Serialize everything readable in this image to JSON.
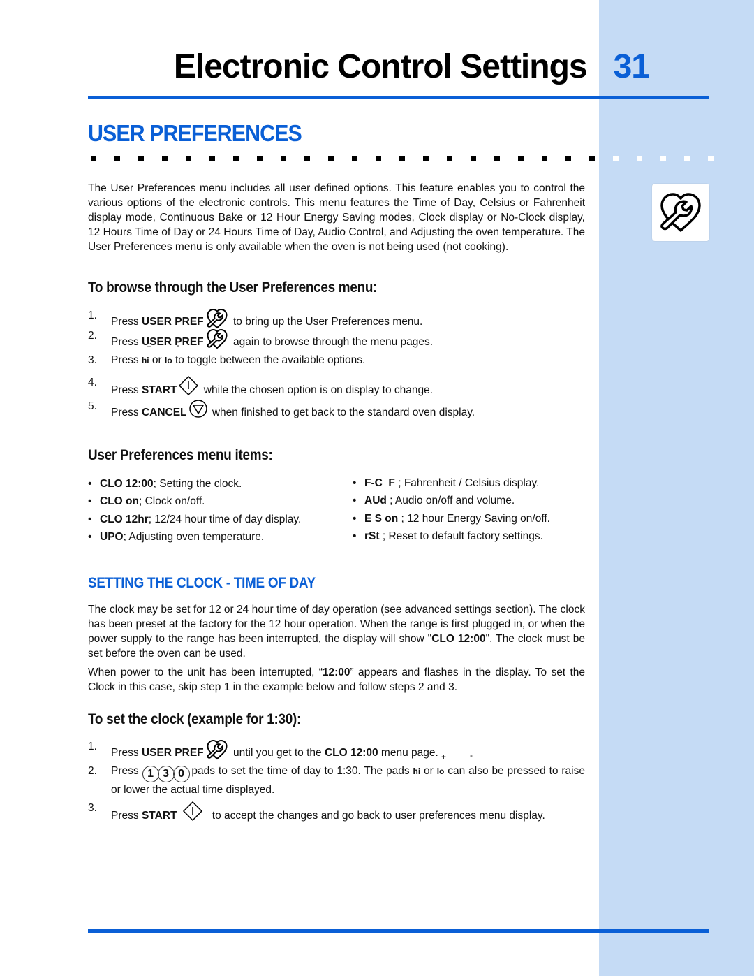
{
  "header": {
    "title": "Electronic Control Settings",
    "page_number": "31"
  },
  "section": {
    "title": "USER PREFERENCES"
  },
  "colors": {
    "accent": "#0a5fd6",
    "sidebar": "#c5dbf5"
  },
  "sidebar_icon": "user-pref-icon",
  "intro": "The User Preferences menu includes all user defined options. This feature enables you to control the various options of the electronic controls. This menu features the Time of Day, Celsius or Fahrenheit display mode, Continuous Bake or 12 Hour Energy Saving modes, Clock display or No-Clock display, 12 Hours Time of Day or 24 Hours Time of Day, Audio Control, and Adjusting the oven temperature. The User Preferences menu is only available when the oven is not being used (not cooking).",
  "browse": {
    "heading": "To browse through the User Preferences menu:",
    "steps": [
      {
        "num": "1.",
        "pre": "Press ",
        "key": "USER PREF",
        "post": " to bring up the User Preferences menu."
      },
      {
        "num": "2.",
        "pre": "Press ",
        "key": "USER PREF",
        "post": " again to browse through the menu pages."
      },
      {
        "num": "3.",
        "pre": "Press ",
        "hi": "hi",
        "or": " or ",
        "lo": "lo",
        "post": " to toggle between the available options.",
        "plus": "+",
        "minus": "-"
      },
      {
        "num": "4.",
        "pre": "Press ",
        "key": "START",
        "post": " while the chosen option is on display to change."
      },
      {
        "num": "5.",
        "pre": "Press ",
        "key": "CANCEL",
        "post": " when finished to get back to the standard oven display."
      }
    ]
  },
  "menu_items": {
    "heading": "User Preferences menu items:",
    "left": [
      {
        "code": "CLO 12:00",
        "desc": "; Setting the clock."
      },
      {
        "code": "CLO on",
        "desc": "; Clock on/off."
      },
      {
        "code": "CLO 12hr",
        "desc": "; 12/24 hour time of day display."
      },
      {
        "code": "UPO",
        "desc": "; Adjusting oven temperature."
      }
    ],
    "right": [
      {
        "code": "F-C  F",
        "desc": " ; Fahrenheit / Celsius display."
      },
      {
        "code": "AUd",
        "desc": " ; Audio on/off and volume."
      },
      {
        "code": "E S on",
        "desc": " ; 12 hour Energy Saving on/off."
      },
      {
        "code": "rSt",
        "desc": " ; Reset to default factory settings."
      }
    ]
  },
  "clock": {
    "heading": "SETTING THE CLOCK - TIME OF DAY",
    "para1_pre": "The clock may be set for 12 or 24 hour time of day operation (see advanced settings section). The clock has been preset at the factory for the 12 hour operation. When the range is first plugged in, or when the power supply to the range has been interrupted, the display will show \"",
    "para1_bold": "CLO 12:00",
    "para1_post": "\". The clock must be set before the oven can be used.",
    "para2_pre": "When power to the unit has been interrupted, “",
    "para2_bold": "12:00",
    "para2_post": "” appears and flashes in the display. To set the Clock in this case, skip step 1 in the example below and follow steps 2 and 3."
  },
  "set_clock": {
    "heading": "To set the clock (example for 1:30):",
    "step1": {
      "num": "1.",
      "pre": "Press ",
      "key": "USER PREF",
      "mid": " until you get to the ",
      "bold": "CLO 12:00",
      "post": " menu page."
    },
    "step2": {
      "num": "2.",
      "pre": "Press ",
      "pads": [
        "1",
        "3",
        "0"
      ],
      "mid": " pads to set the time of day to 1:30. The pads ",
      "hi": "hi",
      "or": " or ",
      "lo": "lo",
      "post": " can also be pressed to raise or lower the actual time displayed.",
      "plus": "+",
      "minus": "-"
    },
    "step3": {
      "num": "3.",
      "pre": "Press ",
      "key": "START",
      "post": " to accept the changes and go back to user preferences menu display."
    }
  }
}
